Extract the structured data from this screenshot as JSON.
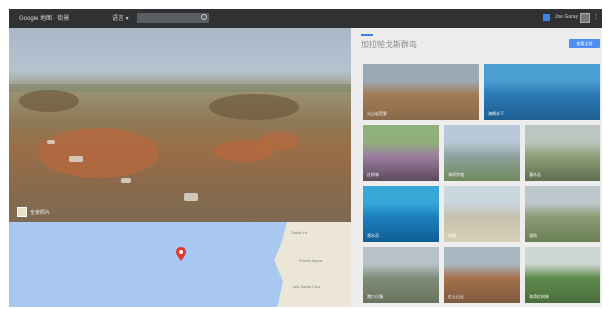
{
  "topbar": {
    "logo": "Google 地图 · 街景",
    "language": "语言 ▾",
    "search_placeholder": "",
    "user_name": "Joe Garay",
    "menu": "⋮"
  },
  "panorama": {
    "label": "全景照片"
  },
  "map": {
    "places": [
      "Santa Fe",
      "Puerto Ayora",
      "Isla Santa Cruz"
    ]
  },
  "panel": {
    "title": "加拉帕戈斯群岛",
    "action_label": "查看全部",
    "photos": [
      {
        "caption": "火山岩荒野",
        "colors": [
          "#9ba9b6",
          "#a37b55",
          "#8a6a4a"
        ]
      },
      {
        "caption": "海狮水下",
        "colors": [
          "#4a9ed1",
          "#2b79b4",
          "#1e5f92"
        ]
      },
      {
        "caption": "红树林",
        "colors": [
          "#8fb07a",
          "#9c7fa0",
          "#5d4a5c"
        ]
      },
      {
        "caption": "海岸步道",
        "colors": [
          "#b7c9d6",
          "#8da3a0",
          "#6f8a5c"
        ]
      },
      {
        "caption": "灌木丛",
        "colors": [
          "#b9c7c0",
          "#90a07a",
          "#5e6e4f"
        ]
      },
      {
        "caption": "潜水员",
        "colors": [
          "#35a8d8",
          "#1c7fbf",
          "#0f5e96"
        ]
      },
      {
        "caption": "海滩",
        "colors": [
          "#c9d7df",
          "#c7c1ad",
          "#d9cfb6"
        ]
      },
      {
        "caption": "湿地",
        "colors": [
          "#bdc8cc",
          "#8a9c74",
          "#6b8056"
        ]
      },
      {
        "caption": "港口小镇",
        "colors": [
          "#b8c2c8",
          "#7f8d79",
          "#6a735f"
        ]
      },
      {
        "caption": "红土山丘",
        "colors": [
          "#aab8c2",
          "#a5704b",
          "#7d5a3f"
        ]
      },
      {
        "caption": "海湾红树林",
        "colors": [
          "#cfd7d3",
          "#5f8b4e",
          "#4a6d3b"
        ]
      }
    ]
  }
}
